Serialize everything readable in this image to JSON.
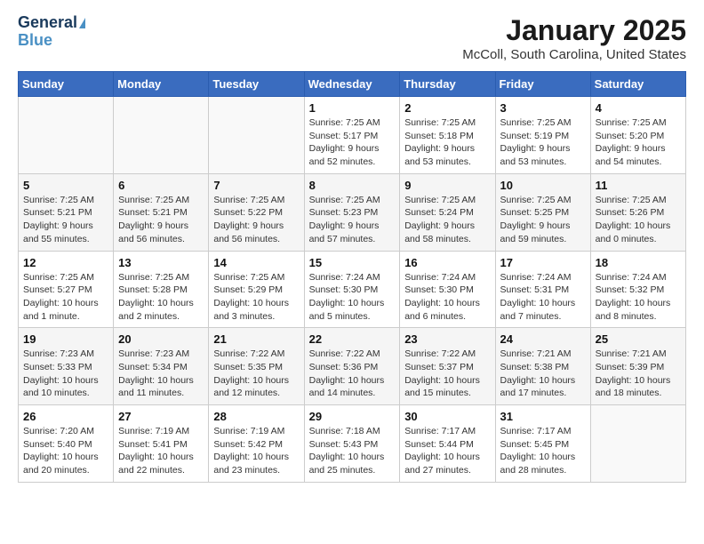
{
  "header": {
    "logo_general": "General",
    "logo_blue": "Blue",
    "month": "January 2025",
    "location": "McColl, South Carolina, United States"
  },
  "days_of_week": [
    "Sunday",
    "Monday",
    "Tuesday",
    "Wednesday",
    "Thursday",
    "Friday",
    "Saturday"
  ],
  "weeks": [
    [
      {
        "day": "",
        "info": ""
      },
      {
        "day": "",
        "info": ""
      },
      {
        "day": "",
        "info": ""
      },
      {
        "day": "1",
        "info": "Sunrise: 7:25 AM\nSunset: 5:17 PM\nDaylight: 9 hours\nand 52 minutes."
      },
      {
        "day": "2",
        "info": "Sunrise: 7:25 AM\nSunset: 5:18 PM\nDaylight: 9 hours\nand 53 minutes."
      },
      {
        "day": "3",
        "info": "Sunrise: 7:25 AM\nSunset: 5:19 PM\nDaylight: 9 hours\nand 53 minutes."
      },
      {
        "day": "4",
        "info": "Sunrise: 7:25 AM\nSunset: 5:20 PM\nDaylight: 9 hours\nand 54 minutes."
      }
    ],
    [
      {
        "day": "5",
        "info": "Sunrise: 7:25 AM\nSunset: 5:21 PM\nDaylight: 9 hours\nand 55 minutes."
      },
      {
        "day": "6",
        "info": "Sunrise: 7:25 AM\nSunset: 5:21 PM\nDaylight: 9 hours\nand 56 minutes."
      },
      {
        "day": "7",
        "info": "Sunrise: 7:25 AM\nSunset: 5:22 PM\nDaylight: 9 hours\nand 56 minutes."
      },
      {
        "day": "8",
        "info": "Sunrise: 7:25 AM\nSunset: 5:23 PM\nDaylight: 9 hours\nand 57 minutes."
      },
      {
        "day": "9",
        "info": "Sunrise: 7:25 AM\nSunset: 5:24 PM\nDaylight: 9 hours\nand 58 minutes."
      },
      {
        "day": "10",
        "info": "Sunrise: 7:25 AM\nSunset: 5:25 PM\nDaylight: 9 hours\nand 59 minutes."
      },
      {
        "day": "11",
        "info": "Sunrise: 7:25 AM\nSunset: 5:26 PM\nDaylight: 10 hours\nand 0 minutes."
      }
    ],
    [
      {
        "day": "12",
        "info": "Sunrise: 7:25 AM\nSunset: 5:27 PM\nDaylight: 10 hours\nand 1 minute."
      },
      {
        "day": "13",
        "info": "Sunrise: 7:25 AM\nSunset: 5:28 PM\nDaylight: 10 hours\nand 2 minutes."
      },
      {
        "day": "14",
        "info": "Sunrise: 7:25 AM\nSunset: 5:29 PM\nDaylight: 10 hours\nand 3 minutes."
      },
      {
        "day": "15",
        "info": "Sunrise: 7:24 AM\nSunset: 5:30 PM\nDaylight: 10 hours\nand 5 minutes."
      },
      {
        "day": "16",
        "info": "Sunrise: 7:24 AM\nSunset: 5:30 PM\nDaylight: 10 hours\nand 6 minutes."
      },
      {
        "day": "17",
        "info": "Sunrise: 7:24 AM\nSunset: 5:31 PM\nDaylight: 10 hours\nand 7 minutes."
      },
      {
        "day": "18",
        "info": "Sunrise: 7:24 AM\nSunset: 5:32 PM\nDaylight: 10 hours\nand 8 minutes."
      }
    ],
    [
      {
        "day": "19",
        "info": "Sunrise: 7:23 AM\nSunset: 5:33 PM\nDaylight: 10 hours\nand 10 minutes."
      },
      {
        "day": "20",
        "info": "Sunrise: 7:23 AM\nSunset: 5:34 PM\nDaylight: 10 hours\nand 11 minutes."
      },
      {
        "day": "21",
        "info": "Sunrise: 7:22 AM\nSunset: 5:35 PM\nDaylight: 10 hours\nand 12 minutes."
      },
      {
        "day": "22",
        "info": "Sunrise: 7:22 AM\nSunset: 5:36 PM\nDaylight: 10 hours\nand 14 minutes."
      },
      {
        "day": "23",
        "info": "Sunrise: 7:22 AM\nSunset: 5:37 PM\nDaylight: 10 hours\nand 15 minutes."
      },
      {
        "day": "24",
        "info": "Sunrise: 7:21 AM\nSunset: 5:38 PM\nDaylight: 10 hours\nand 17 minutes."
      },
      {
        "day": "25",
        "info": "Sunrise: 7:21 AM\nSunset: 5:39 PM\nDaylight: 10 hours\nand 18 minutes."
      }
    ],
    [
      {
        "day": "26",
        "info": "Sunrise: 7:20 AM\nSunset: 5:40 PM\nDaylight: 10 hours\nand 20 minutes."
      },
      {
        "day": "27",
        "info": "Sunrise: 7:19 AM\nSunset: 5:41 PM\nDaylight: 10 hours\nand 22 minutes."
      },
      {
        "day": "28",
        "info": "Sunrise: 7:19 AM\nSunset: 5:42 PM\nDaylight: 10 hours\nand 23 minutes."
      },
      {
        "day": "29",
        "info": "Sunrise: 7:18 AM\nSunset: 5:43 PM\nDaylight: 10 hours\nand 25 minutes."
      },
      {
        "day": "30",
        "info": "Sunrise: 7:17 AM\nSunset: 5:44 PM\nDaylight: 10 hours\nand 27 minutes."
      },
      {
        "day": "31",
        "info": "Sunrise: 7:17 AM\nSunset: 5:45 PM\nDaylight: 10 hours\nand 28 minutes."
      },
      {
        "day": "",
        "info": ""
      }
    ]
  ]
}
